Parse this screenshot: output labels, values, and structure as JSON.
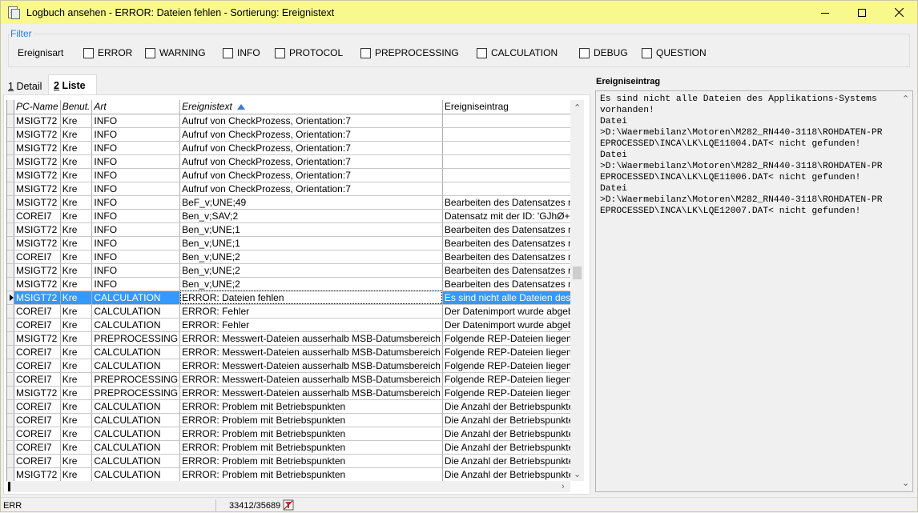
{
  "window": {
    "title": "Logbuch ansehen - ERROR: Dateien fehlen - Sortierung: Ereignistext",
    "colors": {
      "titlebar": "#f8f88c",
      "selection": "#3399ff",
      "filter_legend": "#3478c8"
    }
  },
  "filter": {
    "legend": "Filter",
    "label": "Ereignisart",
    "options": [
      {
        "label": "ERROR",
        "checked": false
      },
      {
        "label": "WARNING",
        "checked": false
      },
      {
        "label": "INFO",
        "checked": false
      },
      {
        "label": "PROTOCOL",
        "checked": false
      },
      {
        "label": "PREPROCESSING",
        "checked": false
      },
      {
        "label": "CALCULATION",
        "checked": false
      },
      {
        "label": "DEBUG",
        "checked": false
      },
      {
        "label": "QUESTION",
        "checked": false
      }
    ]
  },
  "tabs": [
    {
      "key": "1",
      "label": "Detail",
      "active": false
    },
    {
      "key": "2",
      "label": "Liste",
      "active": true
    }
  ],
  "table": {
    "columns": [
      "PC-Name",
      "Benut.",
      "Art",
      "Ereignistext",
      "Ereigniseintrag"
    ],
    "sort_column": "Ereignistext",
    "selected_row": 13,
    "rows": [
      [
        "MSIGT72",
        "Kre",
        "INFO",
        "Aufruf von CheckProzess, Orientation:7",
        ""
      ],
      [
        "MSIGT72",
        "Kre",
        "INFO",
        "Aufruf von CheckProzess, Orientation:7",
        ""
      ],
      [
        "MSIGT72",
        "Kre",
        "INFO",
        "Aufruf von CheckProzess, Orientation:7",
        ""
      ],
      [
        "MSIGT72",
        "Kre",
        "INFO",
        "Aufruf von CheckProzess, Orientation:7",
        ""
      ],
      [
        "MSIGT72",
        "Kre",
        "INFO",
        "Aufruf von CheckProzess, Orientation:7",
        ""
      ],
      [
        "MSIGT72",
        "Kre",
        "INFO",
        "Aufruf von CheckProzess, Orientation:7",
        ""
      ],
      [
        "MSIGT72",
        "Kre",
        "INFO",
        "BeF_v;UNE;49",
        "Bearbeiten des Datensatzes m"
      ],
      [
        "COREI7",
        "Kre",
        "INFO",
        "Ben_v;SAV;2",
        "Datensatz mit der ID: 'GJhØ+6"
      ],
      [
        "MSIGT72",
        "Kre",
        "INFO",
        "Ben_v;UNE;1",
        "Bearbeiten des Datensatzes m"
      ],
      [
        "MSIGT72",
        "Kre",
        "INFO",
        "Ben_v;UNE;1",
        "Bearbeiten des Datensatzes m"
      ],
      [
        "COREI7",
        "Kre",
        "INFO",
        "Ben_v;UNE;2",
        "Bearbeiten des Datensatzes m"
      ],
      [
        "MSIGT72",
        "Kre",
        "INFO",
        "Ben_v;UNE;2",
        "Bearbeiten des Datensatzes m"
      ],
      [
        "MSIGT72",
        "Kre",
        "INFO",
        "Ben_v;UNE;2",
        "Bearbeiten des Datensatzes m"
      ],
      [
        "MSIGT72",
        "Kre",
        "CALCULATION",
        "ERROR: Dateien fehlen",
        "Es sind nicht alle Dateien des A"
      ],
      [
        "COREI7",
        "Kre",
        "CALCULATION",
        "ERROR: Fehler",
        "Der Datenimport wurde abgeb"
      ],
      [
        "COREI7",
        "Kre",
        "CALCULATION",
        "ERROR: Fehler",
        "Der Datenimport wurde abgeb"
      ],
      [
        "MSIGT72",
        "Kre",
        "PREPROCESSING",
        "ERROR: Messwert-Dateien ausserhalb MSB-Datumsbereich",
        "Folgende REP-Dateien liegen a"
      ],
      [
        "COREI7",
        "Kre",
        "CALCULATION",
        "ERROR: Messwert-Dateien ausserhalb MSB-Datumsbereich",
        "Folgende REP-Dateien liegen a"
      ],
      [
        "COREI7",
        "Kre",
        "CALCULATION",
        "ERROR: Messwert-Dateien ausserhalb MSB-Datumsbereich",
        "Folgende REP-Dateien liegen a"
      ],
      [
        "COREI7",
        "Kre",
        "PREPROCESSING",
        "ERROR: Messwert-Dateien ausserhalb MSB-Datumsbereich",
        "Folgende REP-Dateien liegen a"
      ],
      [
        "MSIGT72",
        "Kre",
        "PREPROCESSING",
        "ERROR: Messwert-Dateien ausserhalb MSB-Datumsbereich",
        "Folgende REP-Dateien liegen a"
      ],
      [
        "COREI7",
        "Kre",
        "CALCULATION",
        "ERROR: Problem mit Betriebspunkten",
        "Die Anzahl der Betriebspunkte"
      ],
      [
        "COREI7",
        "Kre",
        "CALCULATION",
        "ERROR: Problem mit Betriebspunkten",
        "Die Anzahl der Betriebspunkte"
      ],
      [
        "COREI7",
        "Kre",
        "CALCULATION",
        "ERROR: Problem mit Betriebspunkten",
        "Die Anzahl der Betriebspunkte"
      ],
      [
        "COREI7",
        "Kre",
        "CALCULATION",
        "ERROR: Problem mit Betriebspunkten",
        "Die Anzahl der Betriebspunkte"
      ],
      [
        "COREI7",
        "Kre",
        "CALCULATION",
        "ERROR: Problem mit Betriebspunkten",
        "Die Anzahl der Betriebspunkte"
      ],
      [
        "MSIGT72",
        "Kre",
        "CALCULATION",
        "ERROR: Problem mit Betriebspunkten",
        "Die Anzahl der Betriebspunkte"
      ]
    ]
  },
  "detail": {
    "title": "Ereigniseintrag",
    "text": "Es sind nicht alle Dateien des Applikations-Systems\nvorhanden!\nDatei\n>D:\\Waermebilanz\\Motoren\\M282_RN440-3118\\ROHDATEN-PR\nEPROCESSED\\INCA\\LK\\LQE11004.DAT< nicht gefunden!\nDatei\n>D:\\Waermebilanz\\Motoren\\M282_RN440-3118\\ROHDATEN-PR\nEPROCESSED\\INCA\\LK\\LQE11006.DAT< nicht gefunden!\nDatei\n>D:\\Waermebilanz\\Motoren\\M282_RN440-3118\\ROHDATEN-PR\nEPROCESSED\\INCA\\LK\\LQE12007.DAT< nicht gefunden!"
  },
  "status": {
    "left": "ERR",
    "count": "33412/35689",
    "icon": "filter-clear-icon"
  }
}
